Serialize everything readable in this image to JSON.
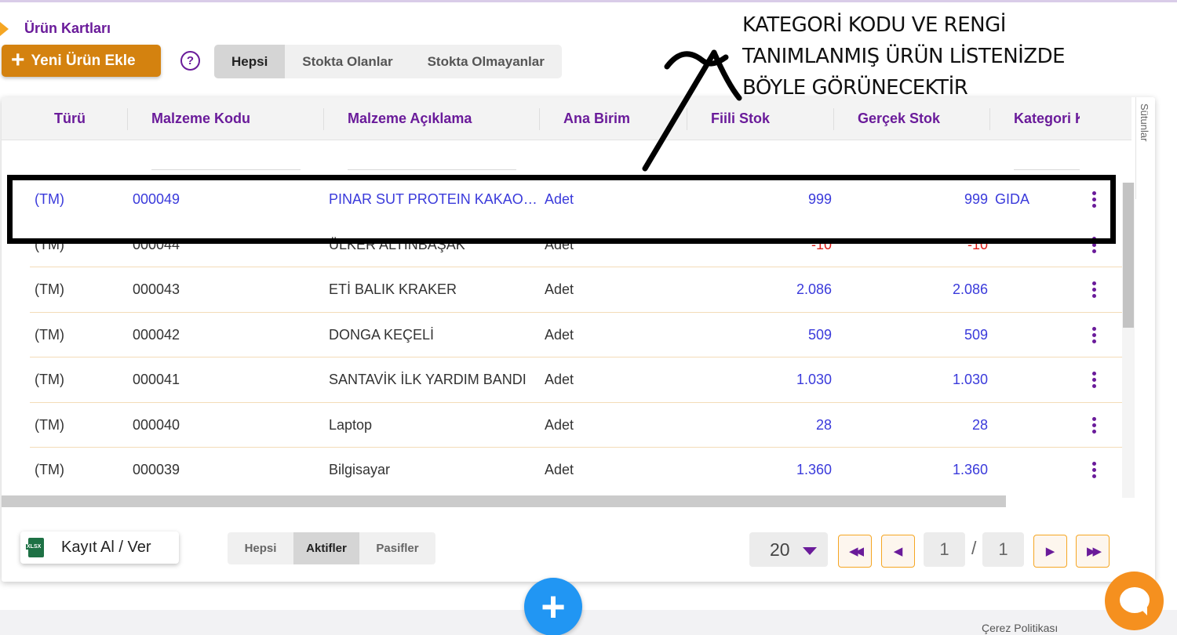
{
  "header": {
    "breadcrumb": "Ürün Kartları",
    "new_button_plus": "+",
    "new_button_label": "Yeni Ürün Ekle",
    "help_glyph": "?"
  },
  "stock_tabs": [
    {
      "label": "Hepsi",
      "active": true
    },
    {
      "label": "Stokta Olanlar",
      "active": false
    },
    {
      "label": "Stokta Olmayanlar",
      "active": false
    }
  ],
  "annotation": {
    "lines": [
      "KATEGORİ KODU VE RENGİ",
      "TANIMLANMIŞ ÜRÜN LİSTENİZDE",
      "BÖYLE GÖRÜNECEKTİR"
    ]
  },
  "table": {
    "columns": [
      "Türü",
      "Malzeme Kodu",
      "Malzeme Açıklama",
      "Ana Birim",
      "Fiili Stok",
      "Gerçek Stok",
      "Kategori K"
    ],
    "side_label": "Sütunlar",
    "rows": [
      {
        "type": "(TM)",
        "code": "000049",
        "desc": "PINAR SUT PROTEIN KAKAOLU",
        "unit": "Adet",
        "fiili": "999",
        "gercek": "999",
        "category": "GIDA",
        "highlighted": true
      },
      {
        "type": "(TM)",
        "code": "000044",
        "desc": "ÜLKER ALTINBAŞAK",
        "unit": "Adet",
        "fiili": "-10",
        "gercek": "-10",
        "category": ""
      },
      {
        "type": "(TM)",
        "code": "000043",
        "desc": "ETİ BALIK KRAKER",
        "unit": "Adet",
        "fiili": "2.086",
        "gercek": "2.086",
        "category": ""
      },
      {
        "type": "(TM)",
        "code": "000042",
        "desc": "DONGA KEÇELİ",
        "unit": "Adet",
        "fiili": "509",
        "gercek": "509",
        "category": ""
      },
      {
        "type": "(TM)",
        "code": "000041",
        "desc": "SANTAVİK İLK YARDIM BANDI",
        "unit": "Adet",
        "fiili": "1.030",
        "gercek": "1.030",
        "category": ""
      },
      {
        "type": "(TM)",
        "code": "000040",
        "desc": "Laptop",
        "unit": "Adet",
        "fiili": "28",
        "gercek": "28",
        "category": ""
      },
      {
        "type": "(TM)",
        "code": "000039",
        "desc": "Bilgisayar",
        "unit": "Adet",
        "fiili": "1.360",
        "gercek": "1.360",
        "category": ""
      }
    ]
  },
  "footer": {
    "export_label": "Kayıt Al / Ver",
    "status_tabs": [
      {
        "label": "Hepsi",
        "active": false
      },
      {
        "label": "Aktifler",
        "active": true
      },
      {
        "label": "Pasifler",
        "active": false
      }
    ],
    "page_size": "20",
    "current_page": "1",
    "separator": "/",
    "total_pages": "1",
    "first_glyph": "◀◀",
    "prev_glyph": "◀",
    "next_glyph": "▶",
    "last_glyph": "▶▶"
  },
  "fab_glyph": "+",
  "cookie_link": "Çerez Politikası",
  "colors": {
    "brand_purple": "#6a1b9a",
    "accent_orange": "#d4820f",
    "positive_blue": "#3a3adb",
    "negative_red": "#e0201a",
    "fab_blue": "#2196f3"
  }
}
